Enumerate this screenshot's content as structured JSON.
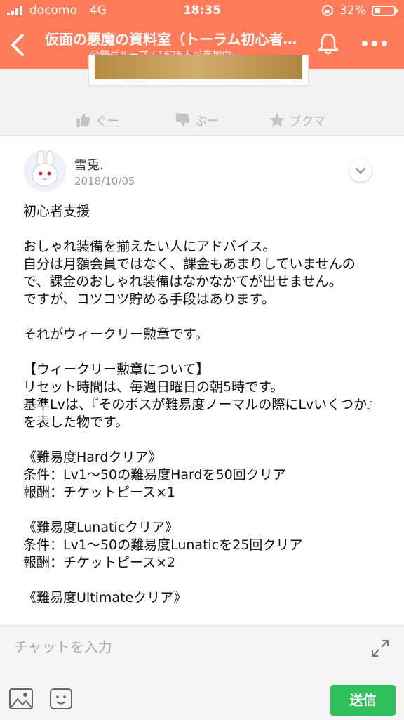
{
  "status_bar": {
    "carrier": "docomo",
    "network": "4G",
    "time": "18:35",
    "battery": "32%"
  },
  "header": {
    "title": "仮面の悪魔の資料室（トーラム初心者…",
    "subtitle": "公開グループ / 1625人が参加中",
    "background_color": "#ff7b5a"
  },
  "reactions": {
    "good": "ぐー",
    "bad": "ぶー",
    "bookmark": "ブクマ"
  },
  "post": {
    "author": "雪兎.",
    "date": "2018/10/05",
    "paragraphs": [
      "初心者支援",
      "おしゃれ装備を揃えたい人にアドバイス。\n自分は月額会員ではなく、課金もあまりしていませんので、課金のおしゃれ装備はなかなかてが出せません。\nですが、コツコツ貯める手段はあります。",
      "それがウィークリー勲章です。",
      "【ウィークリー勲章について】\nリセット時間は、毎週日曜日の朝5時です。\n基準Lvは、『そのボスが難易度ノーマルの際にLvいくつか』を表した物です。",
      "《難易度Hardクリア》\n条件：Lv1〜50の難易度Hardを50回クリア\n報酬：チケットピース×1",
      "《難易度Lunaticクリア》\n条件：Lv1〜50の難易度Lunaticを25回クリア\n報酬：チケットピース×2",
      "《難易度Ultimateクリア》"
    ]
  },
  "chat": {
    "placeholder": "チャットを入力",
    "send_label": "送信",
    "send_color": "#2fc05a"
  }
}
